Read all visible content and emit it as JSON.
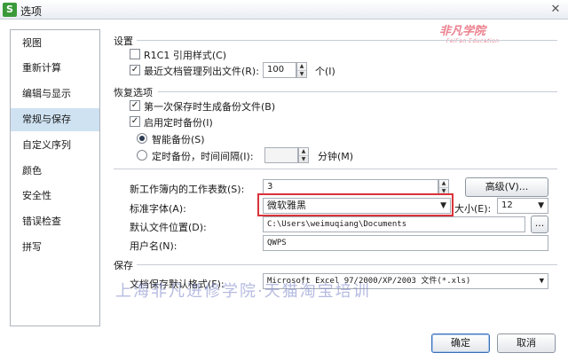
{
  "window": {
    "title": "选项",
    "app_icon_letter": "S"
  },
  "watermark": {
    "logo": "非凡学院",
    "logo_sub": "FeiFan Education",
    "text": "上海非凡进修学院·天猫淘宝培训"
  },
  "sidebar": {
    "items": [
      {
        "label": "视图"
      },
      {
        "label": "重新计算"
      },
      {
        "label": "编辑与显示"
      },
      {
        "label": "常规与保存",
        "active": true
      },
      {
        "label": "自定义序列"
      },
      {
        "label": "颜色"
      },
      {
        "label": "安全性"
      },
      {
        "label": "错误检查"
      },
      {
        "label": "拼写"
      }
    ]
  },
  "settings": {
    "title": "设置",
    "r1c1_label": "R1C1 引用样式(C)",
    "r1c1_checked": false,
    "recent_label": "最近文档管理列出文件(R):",
    "recent_checked": true,
    "recent_value": "100",
    "recent_unit": "个(I)"
  },
  "recovery": {
    "title": "恢复选项",
    "first_save_label": "第一次保存时生成备份文件(B)",
    "first_save_checked": true,
    "timed_label": "启用定时备份(I)",
    "timed_checked": true,
    "smart_label": "智能备份(S)",
    "smart_selected": true,
    "interval_label": "定时备份，时间间隔(I):",
    "interval_value": "",
    "interval_unit": "分钟(M)"
  },
  "workbook": {
    "sheets_label": "新工作簿内的工作表数(S):",
    "sheets_value": "3",
    "advanced_button": "高级(V)...",
    "font_label": "标准字体(A):",
    "font_value": "微软雅黑",
    "size_label": "大小(E):",
    "size_value": "12",
    "location_label": "默认文件位置(D):",
    "location_value": "C:\\Users\\weimuqiang\\Documents",
    "browse_button": "...",
    "username_label": "用户名(N):",
    "username_value": "QWPS"
  },
  "save": {
    "title": "保存",
    "format_label": "文档保存默认格式(F):",
    "format_value": "Microsoft Excel 97/2000/XP/2003 文件(*.xls)"
  },
  "footer": {
    "ok_button": "确定",
    "cancel_button": "取消"
  },
  "icons": {
    "close": "close-icon",
    "check": "check-icon",
    "chevron_down": "chevron-down-icon"
  }
}
